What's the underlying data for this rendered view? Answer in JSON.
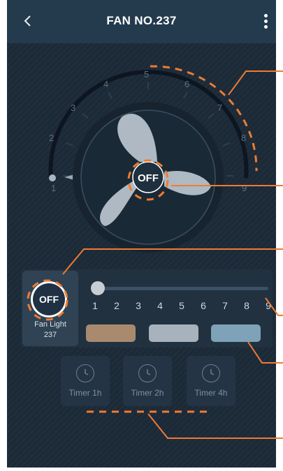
{
  "header": {
    "title": "FAN NO.237",
    "back_icon": "chevron-left-icon",
    "menu_icon": "more-vertical-icon"
  },
  "fan": {
    "speed_scale": [
      "1",
      "2",
      "3",
      "4",
      "5",
      "6",
      "7",
      "8",
      "9"
    ],
    "state_label": "OFF",
    "current_speed": 1
  },
  "light": {
    "state_label": "OFF",
    "name_line1": "Fan Light",
    "name_line2": "237"
  },
  "speed_slider": {
    "numbers": [
      "1",
      "2",
      "3",
      "4",
      "5",
      "6",
      "7",
      "8",
      "9"
    ],
    "value": 1
  },
  "colors": {
    "accent": "#f07b2f",
    "background": "#1c2a38",
    "swatches": [
      "#a98a6f",
      "#a7b2bc",
      "#7ea2b8"
    ]
  },
  "timers": [
    {
      "label": "Timer 1h",
      "icon": "timer-icon"
    },
    {
      "label": "Timer 2h",
      "icon": "timer-icon"
    },
    {
      "label": "Timer 4h",
      "icon": "timer-icon"
    }
  ]
}
